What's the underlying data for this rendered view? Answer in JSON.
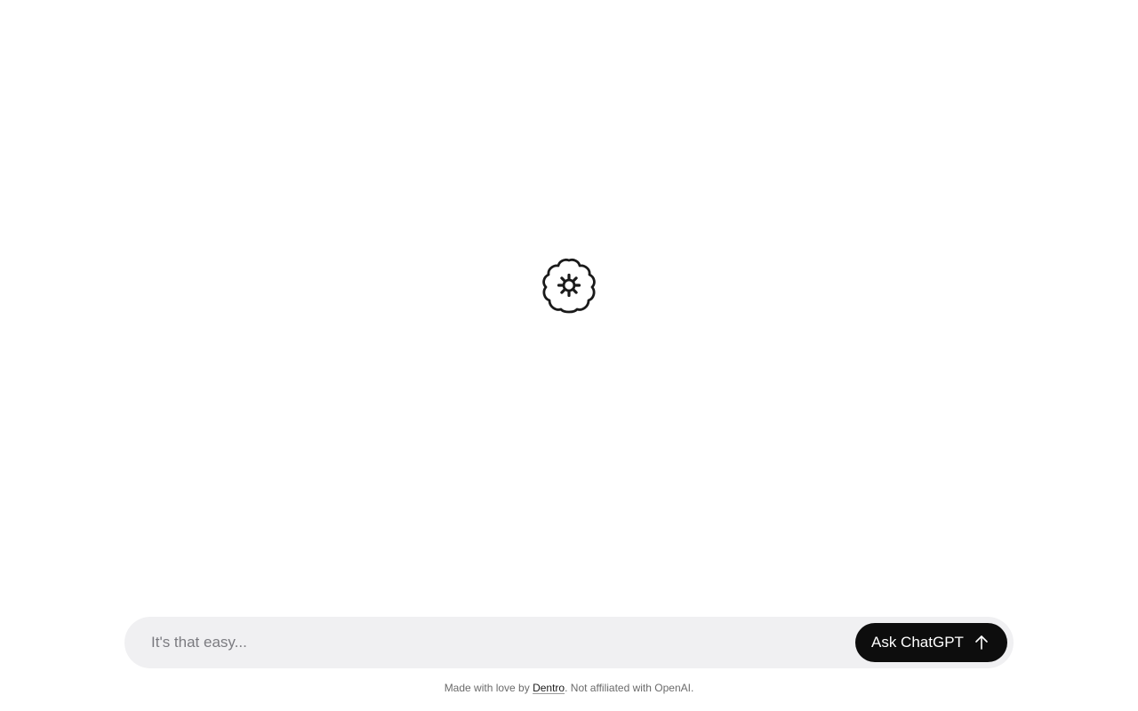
{
  "logo": {
    "icon": "brain-gear-icon",
    "color": "#1a1a1a"
  },
  "composer": {
    "placeholder": "It's that easy...",
    "value": "",
    "button_label": "Ask ChatGPT",
    "button_icon": "arrow-up-icon",
    "background": "#f0f0f2",
    "button_color": "#0d0d0d"
  },
  "footer": {
    "prefix": "Made with love by ",
    "link_text": "Dentro",
    "suffix": ". Not affiliated with OpenAI."
  }
}
